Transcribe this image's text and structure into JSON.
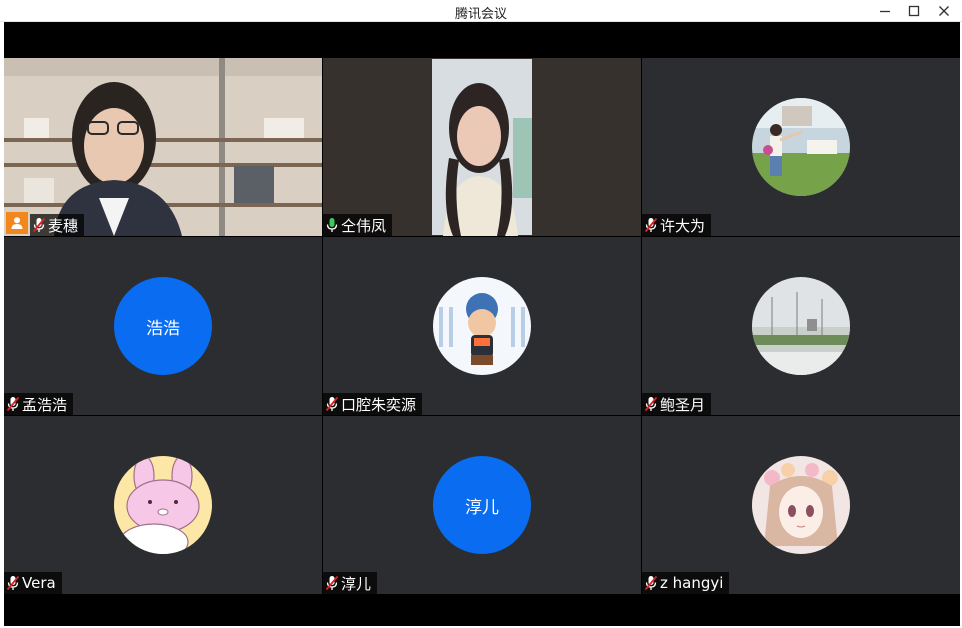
{
  "window": {
    "title": "腾讯会议"
  },
  "participants": [
    {
      "name": "麦穗",
      "muted": true,
      "host": true,
      "video": true
    },
    {
      "name": "仝伟凤",
      "muted": false,
      "speaking": true,
      "video": true
    },
    {
      "name": "许大为",
      "muted": true,
      "avatar": "photo-avatar"
    },
    {
      "name": "孟浩浩",
      "muted": true,
      "avatar_text": "浩浩"
    },
    {
      "name": "口腔朱奕源",
      "muted": true,
      "avatar": "cartoon-avatar"
    },
    {
      "name": "鲍圣月",
      "muted": true,
      "avatar": "landscape-avatar"
    },
    {
      "name": "Vera",
      "muted": true,
      "avatar": "bunny-avatar"
    },
    {
      "name": "淳儿",
      "muted": true,
      "avatar_text": "淳儿"
    },
    {
      "name": "z hangyi",
      "muted": true,
      "avatar": "anime-avatar"
    }
  ],
  "colors": {
    "tile_bg": "#2b2d30",
    "text_avatar": "#0a6cf0",
    "speaking_border": "#3ec85a",
    "host_badge": "#f2871d",
    "muted_mic": "#e02020",
    "active_mic": "#3ec85a"
  }
}
